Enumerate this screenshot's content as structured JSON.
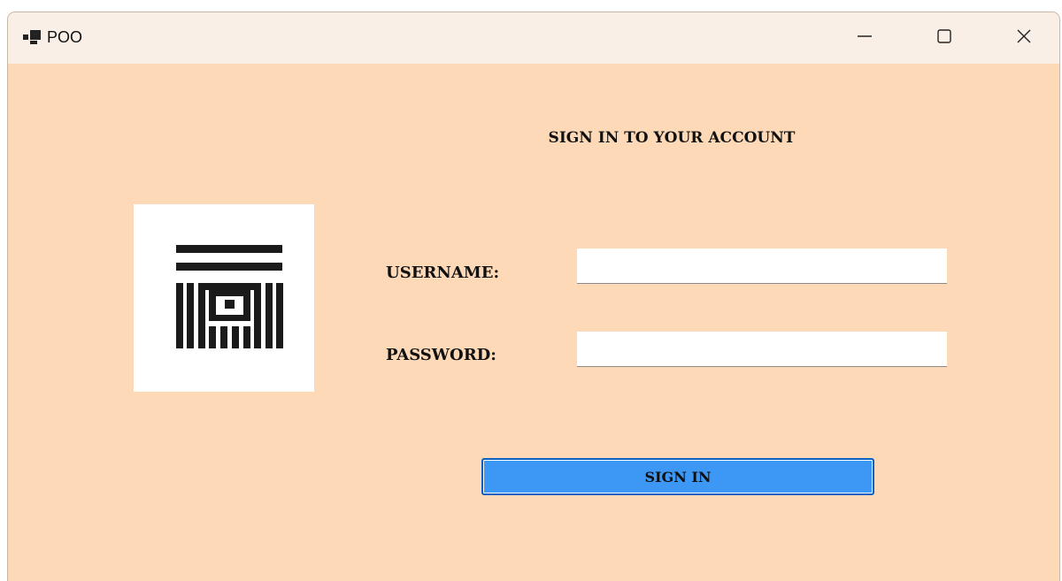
{
  "window": {
    "title": "POO",
    "controls": {
      "minimize_icon": "minimize-icon",
      "maximize_icon": "maximize-icon",
      "close_icon": "close-icon"
    }
  },
  "form": {
    "heading": "SIGN IN TO YOUR ACCOUNT",
    "username_label": "USERNAME:",
    "username_value": "",
    "password_label": "PASSWORD:",
    "password_value": "",
    "submit_label": "SIGN IN"
  },
  "logo": {
    "icon": "logo-icon"
  },
  "colors": {
    "window_background": "#fdd9b7",
    "titlebar_background": "#faefe6",
    "button_background": "#3d98f5",
    "button_border": "#0a5fc2",
    "text": "#111111"
  }
}
